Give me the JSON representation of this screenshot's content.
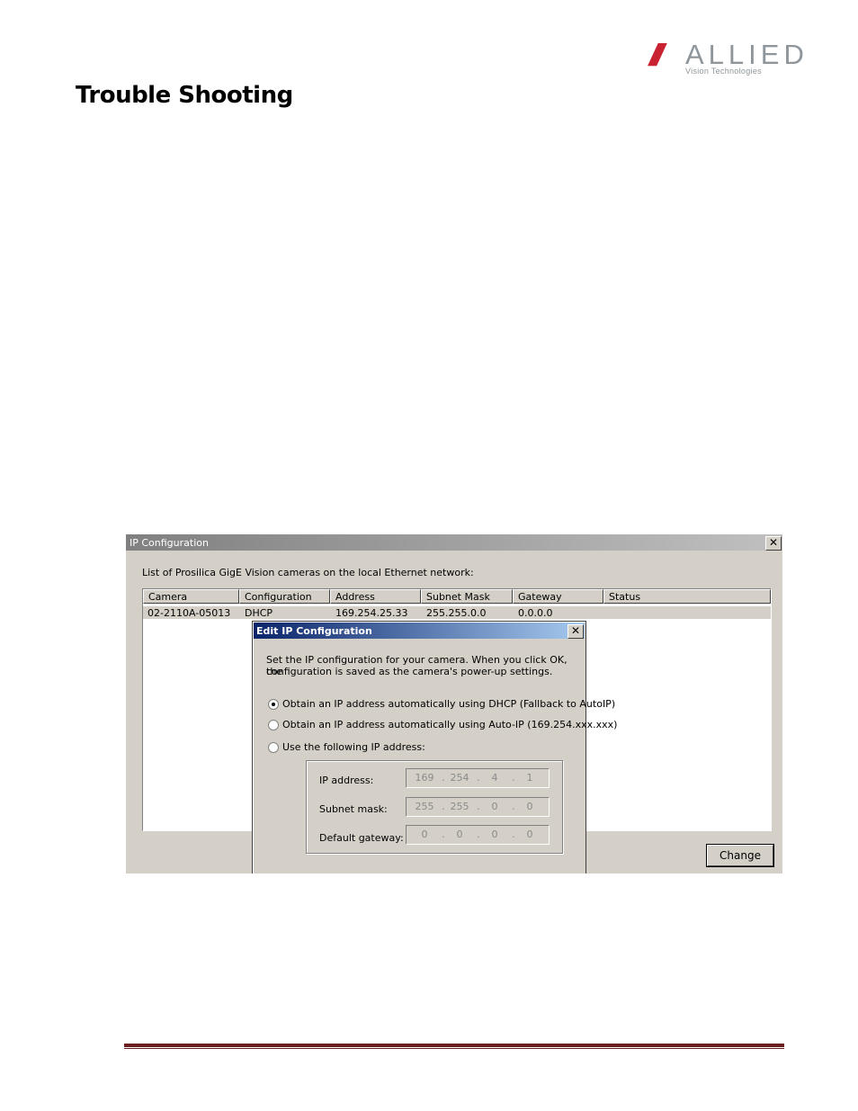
{
  "logo": {
    "slashes": "////",
    "word": "ALLIED",
    "sub": "Vision Technologies",
    "brand_red": "#c8202e",
    "brand_grey": "#8f969b"
  },
  "page_title": "Trouble Shooting",
  "ip_config_window": {
    "title": "IP Configuration",
    "close_glyph": "✕",
    "intro": "List of Prosilica GigE Vision cameras on the local Ethernet network:",
    "columns": [
      "Camera",
      "Configuration Mode",
      "Address",
      "Subnet Mask",
      "Gateway",
      "Status"
    ],
    "rows": [
      [
        "02-2110A-05013",
        "DHCP",
        "169.254.25.33",
        "255.255.0.0",
        "0.0.0.0",
        ""
      ]
    ],
    "change_label": "Change"
  },
  "edit_dialog": {
    "title": "Edit IP Configuration",
    "close_glyph": "✕",
    "description_line1": "Set the IP configuration for your camera.  When you click OK, the",
    "description_line2": "configuration is saved as the camera's power-up settings.",
    "options": [
      {
        "label": "Obtain an IP address automatically using DHCP (Fallback to AutoIP)",
        "checked": true
      },
      {
        "label": "Obtain an IP address automatically using Auto-IP (169.254.xxx.xxx)",
        "checked": false
      },
      {
        "label": "Use the following IP address:",
        "checked": false
      }
    ],
    "fields": {
      "ip_label": "IP address:",
      "ip": [
        "169",
        "254",
        "4",
        "1"
      ],
      "mask_label": "Subnet mask:",
      "mask": [
        "255",
        "255",
        "0",
        "0"
      ],
      "gateway_label": "Default gateway:",
      "gateway": [
        "0",
        "0",
        "0",
        "0"
      ]
    }
  },
  "footer_color": "#6b1f1f"
}
